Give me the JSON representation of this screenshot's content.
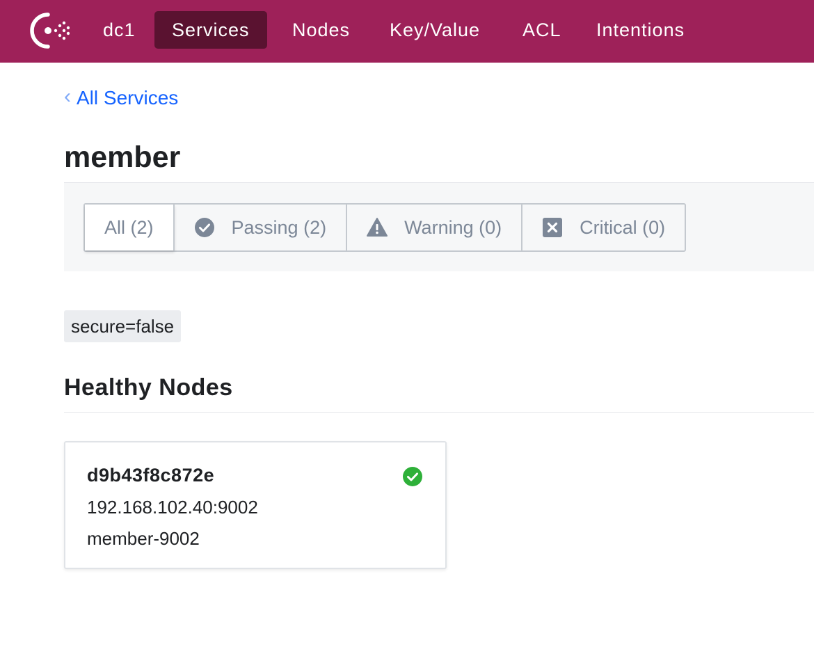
{
  "nav": {
    "datacenter": "dc1",
    "items": [
      {
        "label": "Services",
        "active": true
      },
      {
        "label": "Nodes",
        "active": false
      },
      {
        "label": "Key/Value",
        "active": false
      },
      {
        "label": "ACL",
        "active": false
      },
      {
        "label": "Intentions",
        "active": false
      }
    ],
    "brand_color": "#9e2159",
    "active_color": "#5a1230"
  },
  "breadcrumb": {
    "chevron": "‹",
    "label": "All Services"
  },
  "service": {
    "name": "member"
  },
  "filters": [
    {
      "label": "All (2)",
      "icon": "none",
      "selected": true
    },
    {
      "label": "Passing (2)",
      "icon": "check-circle-icon",
      "selected": false
    },
    {
      "label": "Warning (0)",
      "icon": "warning-icon",
      "selected": false
    },
    {
      "label": "Critical (0)",
      "icon": "x-square-icon",
      "selected": false
    }
  ],
  "tags": [
    "secure=false"
  ],
  "healthy_nodes": {
    "title": "Healthy Nodes",
    "items": [
      {
        "name": "d9b43f8c872e",
        "address": "192.168.102.40:9002",
        "service_id": "member-9002",
        "status": "passing",
        "status_color": "#2eb039"
      }
    ]
  }
}
